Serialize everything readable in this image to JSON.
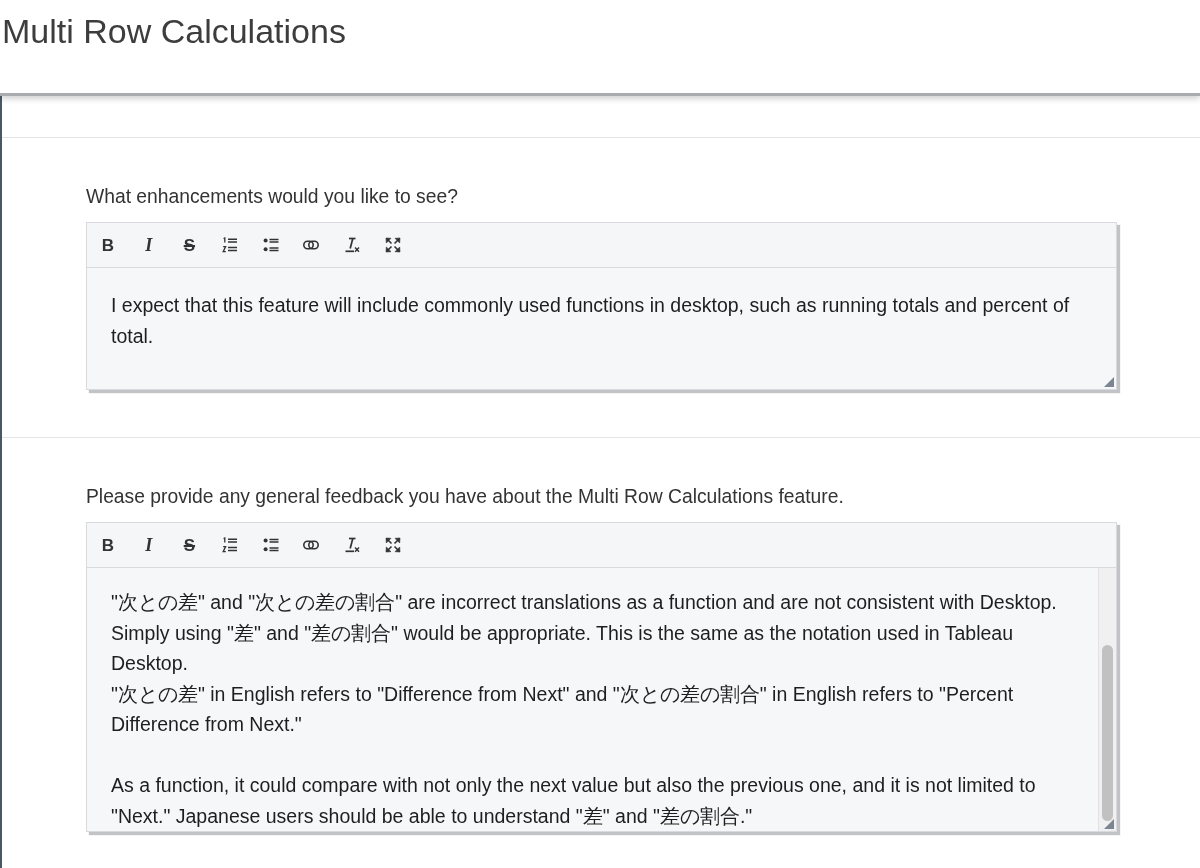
{
  "header": {
    "title": "Multi Row Calculations"
  },
  "questions": [
    {
      "label": "What enhancements would you like to see?",
      "toolbar": [
        {
          "kind": "bold",
          "glyph": "B"
        },
        {
          "kind": "italic",
          "glyph": "I"
        },
        {
          "kind": "strikethrough",
          "glyph": "S"
        },
        {
          "kind": "ordered-list"
        },
        {
          "kind": "bullet-list"
        },
        {
          "kind": "link"
        },
        {
          "kind": "clear-format"
        },
        {
          "kind": "fullscreen"
        }
      ],
      "answer": "I expect that this feature will include commonly used functions in desktop, such as running totals and percent of total.",
      "has_scrollbar": false
    },
    {
      "label": "Please provide any general feedback you have about the Multi Row Calculations feature.",
      "toolbar": [
        {
          "kind": "bold",
          "glyph": "B"
        },
        {
          "kind": "italic",
          "glyph": "I"
        },
        {
          "kind": "strikethrough",
          "glyph": "S"
        },
        {
          "kind": "ordered-list"
        },
        {
          "kind": "bullet-list"
        },
        {
          "kind": "link"
        },
        {
          "kind": "clear-format"
        },
        {
          "kind": "fullscreen"
        }
      ],
      "answer": "\"次との差\" and \"次との差の割合\" are incorrect translations as a function and are not consistent with Desktop. Simply using \"差\" and \"差の割合\" would be appropriate. This is the same as the notation used in Tableau Desktop.\n\"次との差\" in English refers to \"Difference from Next\" and \"次との差の割合\" in English refers to \"Percent Difference from Next.\"\n\nAs a function, it could compare with not only the next value but also the previous one, and it is not limited to \"Next.\" Japanese users should be able to understand \"差\" and \"差の割合.\"",
      "has_scrollbar": true
    }
  ]
}
